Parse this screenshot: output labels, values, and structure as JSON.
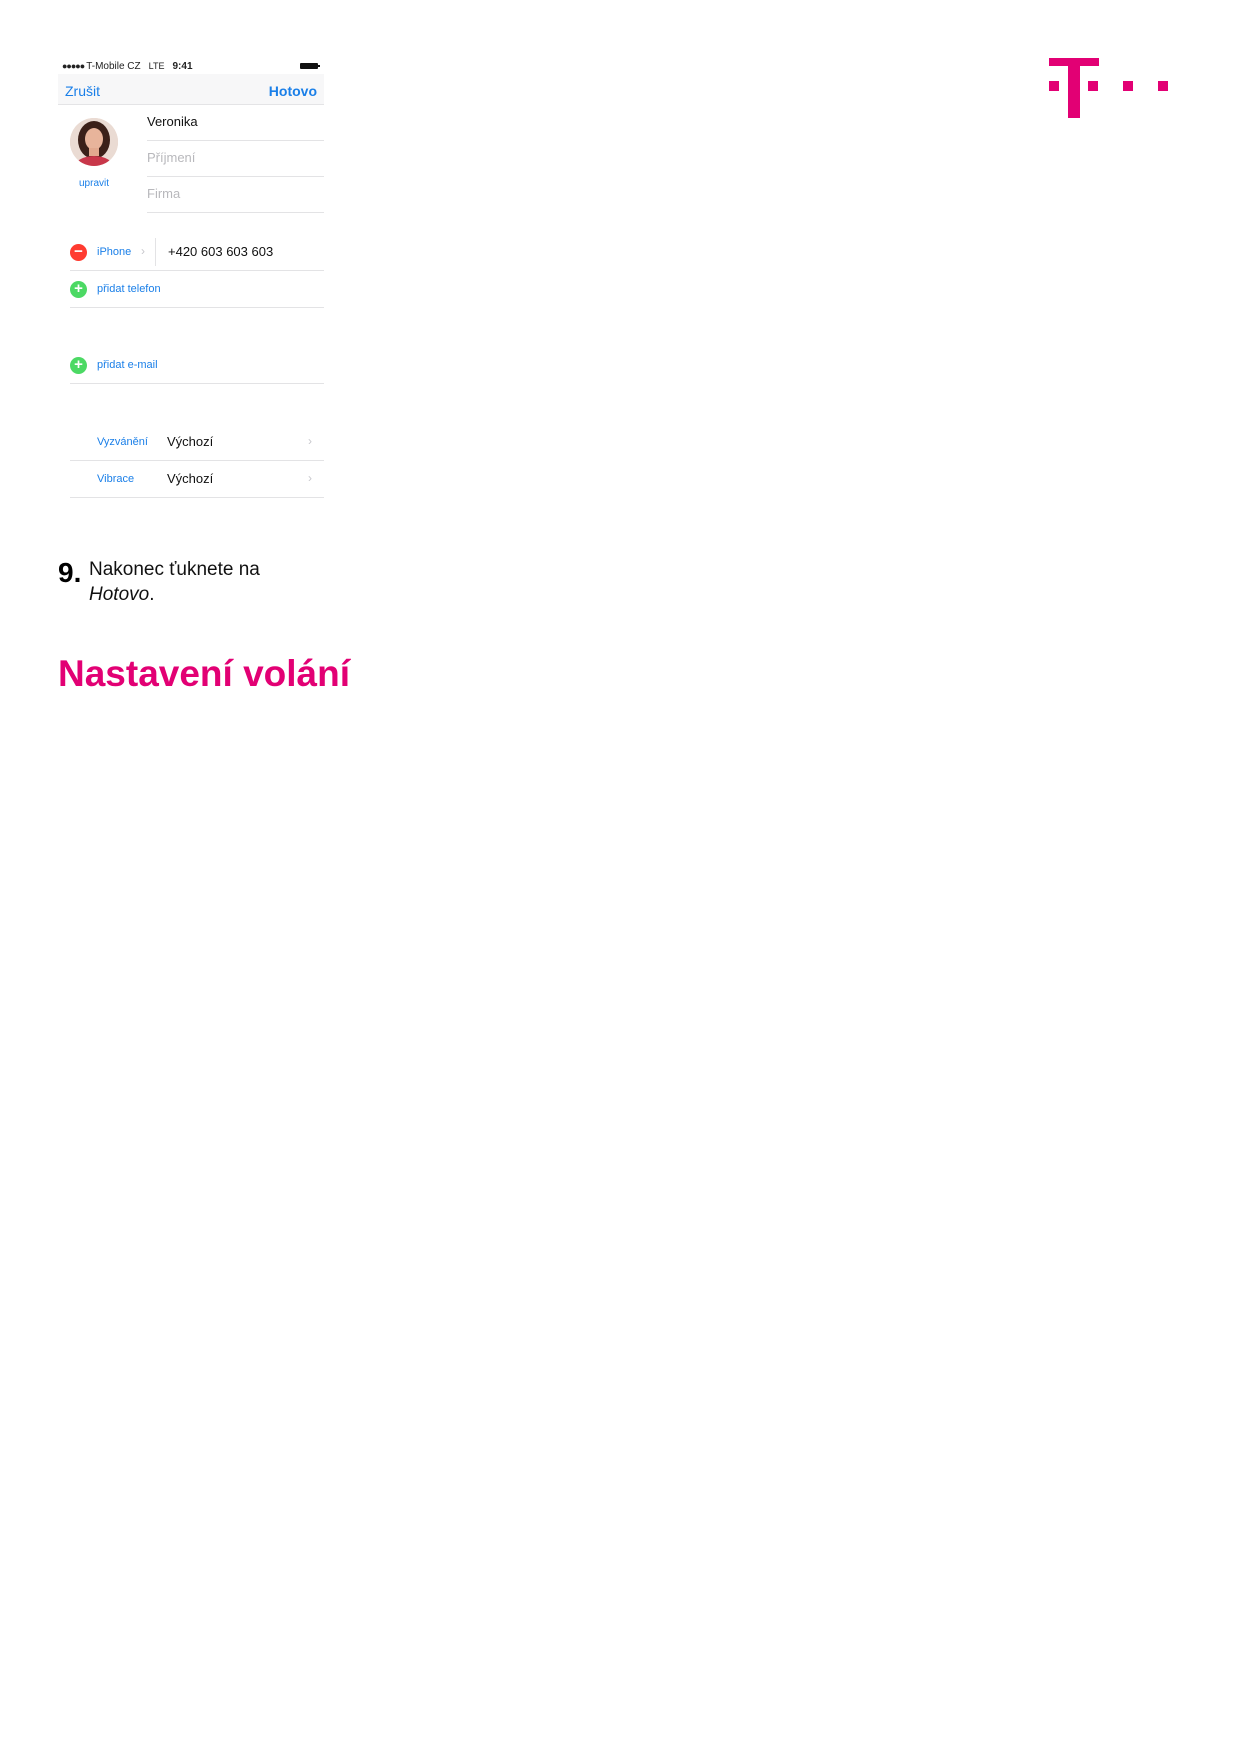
{
  "brand": {
    "accent_color": "#e20074",
    "logo": "t-logo-icon"
  },
  "phone_screenshot": {
    "status_bar": {
      "signal": "●●●●●",
      "carrier": "T-Mobile CZ",
      "network": "LTE",
      "time": "9:41"
    },
    "nav": {
      "cancel_label": "Zrušit",
      "done_label": "Hotovo"
    },
    "avatar": {
      "edit_label": "upravit"
    },
    "fields": {
      "first_name": "Veronika",
      "last_name_placeholder": "Příjmení",
      "company_placeholder": "Firma"
    },
    "phone_row": {
      "remove_icon": "−",
      "label": "iPhone",
      "chevron": "›",
      "number": "+420 603 603 603"
    },
    "add_phone": {
      "add_icon": "+",
      "label": "přidat telefon"
    },
    "add_email": {
      "add_icon": "+",
      "label": "přidat e-mail"
    },
    "ringtone": {
      "label": "Vyzvánění",
      "value": "Výchozí",
      "chevron": "›"
    },
    "vibration": {
      "label": "Vibrace",
      "value": "Výchozí",
      "chevron": "›"
    }
  },
  "instruction": {
    "number": "9.",
    "text_line1": "Nakonec ťuknete na",
    "text_emphasis": "Hotovo",
    "text_end": "."
  },
  "section_heading": "Nastavení volání"
}
